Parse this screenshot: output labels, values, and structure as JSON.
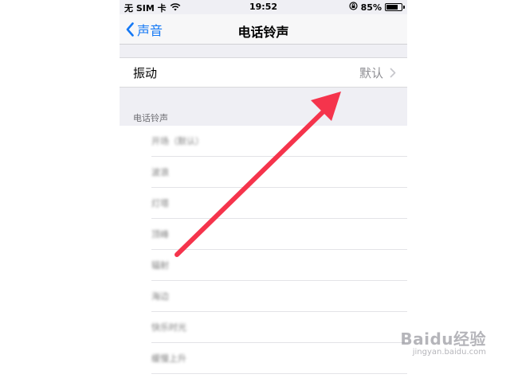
{
  "status_bar": {
    "carrier": "无 SIM 卡",
    "time": "19:52",
    "battery_percent": "85%",
    "battery_level": 0.85,
    "icons": [
      "wifi-icon",
      "orientation-lock-icon",
      "battery-icon"
    ]
  },
  "nav": {
    "back_label": "声音",
    "title": "电话铃声"
  },
  "vibration": {
    "label": "振动",
    "value": "默认"
  },
  "ringtones": {
    "section_header": "电话铃声",
    "items": [
      "开场（默认）",
      "波浪",
      "灯塔",
      "顶峰",
      "辐射",
      "海边",
      "快乐时光",
      "缓慢上升"
    ]
  },
  "watermark": {
    "brand": "Baidu经验",
    "url": "jingyan.baidu.com"
  },
  "colors": {
    "accent": "#1478f5",
    "annotation_arrow": "#f5344c",
    "background": "#efeff4"
  }
}
